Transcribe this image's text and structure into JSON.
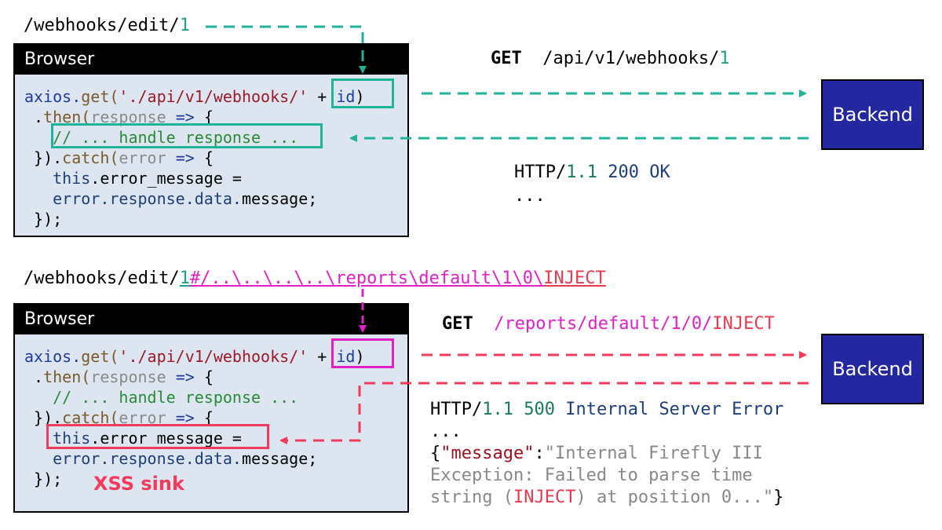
{
  "top": {
    "url_prefix": "/webhooks/edit/",
    "url_id": "1",
    "browser_title": "Browser",
    "request_method": "GET",
    "request_path": "/api/v1/webhooks/",
    "request_id": "1",
    "response_proto": "HTTP/",
    "response_version": "1.1",
    "response_status": "200 OK",
    "response_ellipsis": "...",
    "backend_label": "Backend",
    "code": {
      "l1_obj": "axios.",
      "l1_fn": "get(",
      "l1_str": "'./api/v1/webhooks/'",
      "l1_plus": "+ ",
      "l1_id": "id",
      "l1_close": ")",
      "l2_dot": ".",
      "l2_fn": "then(",
      "l2_param": "response",
      "l2_arrow": "=>",
      "l2_brace": " {",
      "l3": "// ... handle response ...",
      "l4_start": "}).",
      "l4_fn": "catch(",
      "l4_param": "error",
      "l4_arrow": "=>",
      "l4_brace": " {",
      "l5_this": "this",
      "l5_rest": ".error_message =",
      "l6_error": "error.",
      "l6_response": "response.",
      "l6_data": "data.",
      "l6_rest": "message;",
      "l7": "});"
    }
  },
  "bottom": {
    "url_prefix": "/webhooks/edit/",
    "url_id": "1",
    "url_payload": "#/..\\..\\..\\..\\reports\\default\\1\\0\\",
    "url_inject": "INJECT",
    "browser_title": "Browser",
    "request_method": "GET",
    "request_path": "/reports/default/1/0/",
    "request_inject": "INJECT",
    "response_proto": "HTTP/",
    "response_version": "1.1",
    "response_code": "500",
    "response_reason": "Internal Server Error",
    "response_ellipsis": "...",
    "json_open": "{",
    "json_key": "\"message\"",
    "json_colon": ":",
    "json_val1": "\"Internal Firefly III",
    "json_val2": "Exception: Failed to parse time",
    "json_val3_a": "string (",
    "json_val3_inject": "INJECT",
    "json_val3_b": ") at position 0...\"",
    "json_close": "}",
    "backend_label": "Backend",
    "sink_label": "XSS sink",
    "code": {
      "l1_obj": "axios.",
      "l1_fn": "get(",
      "l1_str": "'./api/v1/webhooks/'",
      "l1_plus": "+ ",
      "l1_id": "id",
      "l1_close": ")",
      "l2_dot": ".",
      "l2_fn": "then(",
      "l2_param": "response",
      "l2_arrow": "=>",
      "l2_brace": " {",
      "l3": "// ... handle response ...",
      "l4_start": "}).",
      "l4_fn": "catch(",
      "l4_param": "error",
      "l4_arrow": "=>",
      "l4_brace": " {",
      "l5_this": "this",
      "l5_rest": ".error_message =",
      "l6_error": "error.",
      "l6_response": "response.",
      "l6_data": "data.",
      "l6_rest": "message;",
      "l7": "});"
    }
  },
  "colors": {
    "teal_accent": "#1fb39a",
    "magenta_accent": "#e020c8",
    "pink_accent": "#f23a5c",
    "backend_fill": "#2328a0",
    "browser_fill": "#dde6f0"
  }
}
